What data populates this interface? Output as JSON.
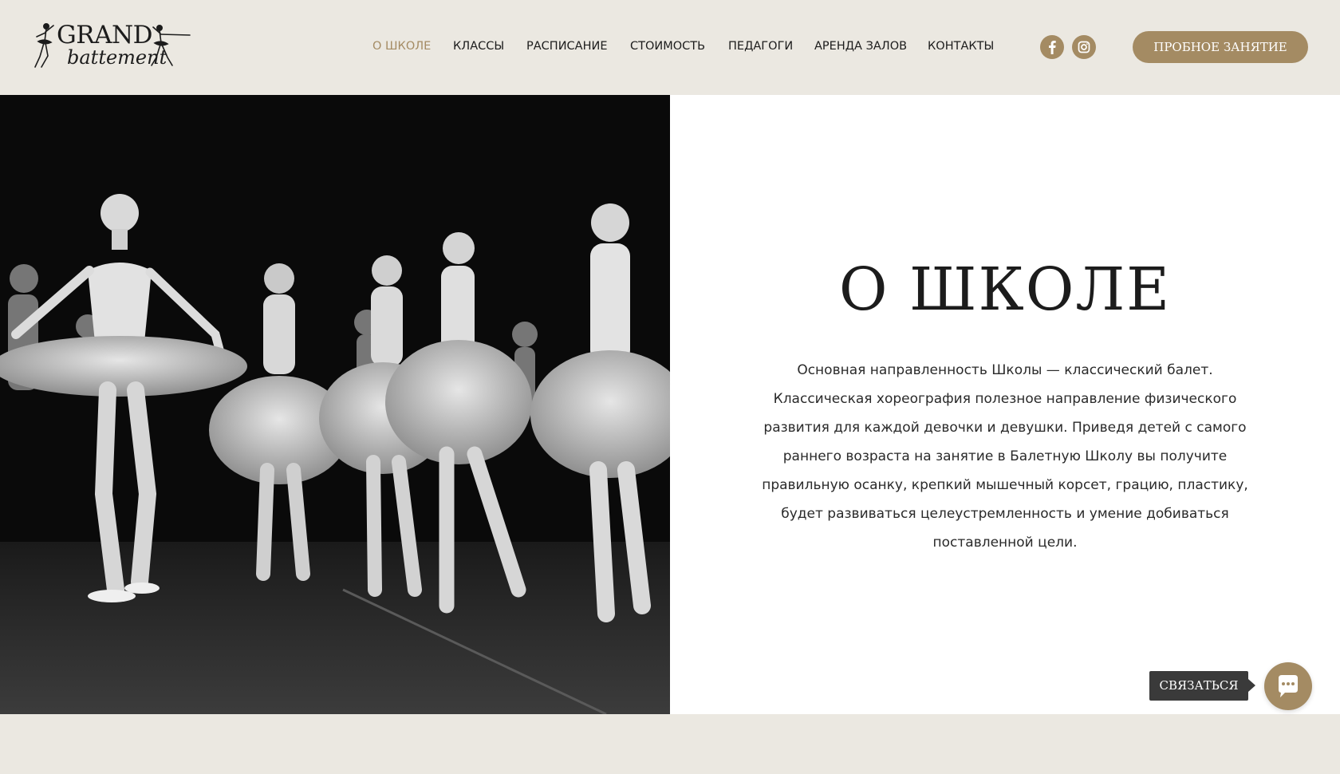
{
  "header": {
    "logo": {
      "line1": "GRAND",
      "line2": "battement"
    },
    "nav": [
      {
        "label": "О ШКОЛЕ",
        "active": true
      },
      {
        "label": "КЛАССЫ",
        "active": false
      },
      {
        "label": "РАСПИСАНИЕ",
        "active": false
      },
      {
        "label": "СТОИМОСТЬ",
        "active": false
      },
      {
        "label": "ПЕДАГОГИ",
        "active": false
      },
      {
        "label": "АРЕНДА ЗАЛОВ",
        "active": false
      },
      {
        "label": "КОНТАКТЫ",
        "active": false
      }
    ],
    "social": [
      {
        "icon": "facebook-icon"
      },
      {
        "icon": "instagram-icon"
      }
    ],
    "cta_label": "ПРОБНОЕ ЗАНЯТИЕ"
  },
  "hero": {
    "title": "О ШКОЛЕ",
    "description": "Основная направленность Школы — классический балет. Классическая хореография полезное направление физического развития для каждой девочки и девушки. Приведя детей с самого раннего возраста на занятие в Балетную Школу вы получите правильную осанку, крепкий мышечный корсет, грацию, пластику, будет развиваться целеустремленность и умение добиваться поставленной цели."
  },
  "chat": {
    "label": "СВЯЗАТЬСЯ",
    "icon": "chat-bubble-icon"
  },
  "colors": {
    "accent": "#a48b63",
    "background": "#ebe8e1",
    "panel": "#ffffff",
    "text": "#1c1c1c",
    "tooltip": "#3a3a3a"
  }
}
